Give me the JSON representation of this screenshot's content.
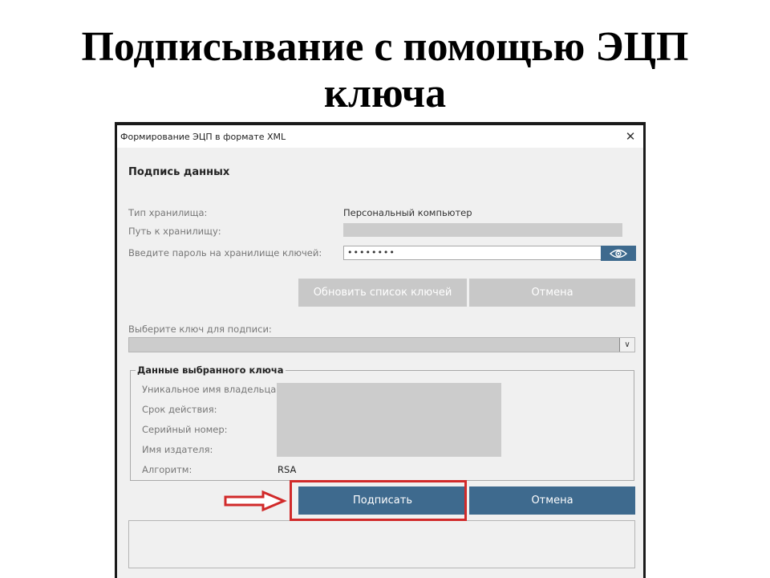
{
  "slide": {
    "title_line1": "Подписывание с помощью ЭЦП",
    "title_line2": "ключа"
  },
  "window": {
    "title": "Формирование ЭЦП в формате XML",
    "close_glyph": "✕"
  },
  "form": {
    "section_title": "Подпись данных",
    "storage_type_label": "Тип хранилища:",
    "storage_type_value": "Персональный компьютер",
    "storage_path_label": "Путь к хранилищу:",
    "password_label": "Введите пароль на хранилище ключей:",
    "password_value": "••••••••",
    "refresh_button": "Обновить список ключей",
    "cancel_button_top": "Отмена",
    "select_key_label": "Выберите ключ для подписи:",
    "combo_arrow": "∨"
  },
  "key_details": {
    "group_title": "Данные выбранного ключа",
    "owner_label": "Уникальное имя владельца:",
    "validity_label": "Срок действия:",
    "serial_label": "Серийный номер:",
    "issuer_label": "Имя издателя:",
    "algorithm_label": "Алгоритм:",
    "algorithm_value": "RSA"
  },
  "actions": {
    "sign_button": "Подписать",
    "cancel_button": "Отмена"
  },
  "icons": {
    "eye": "eye-icon",
    "close": "close-icon",
    "arrow": "arrow-right-icon"
  },
  "colors": {
    "accent": "#3e6a8e",
    "highlight": "#d12a2a",
    "disabled_button": "#c8c8c8"
  }
}
